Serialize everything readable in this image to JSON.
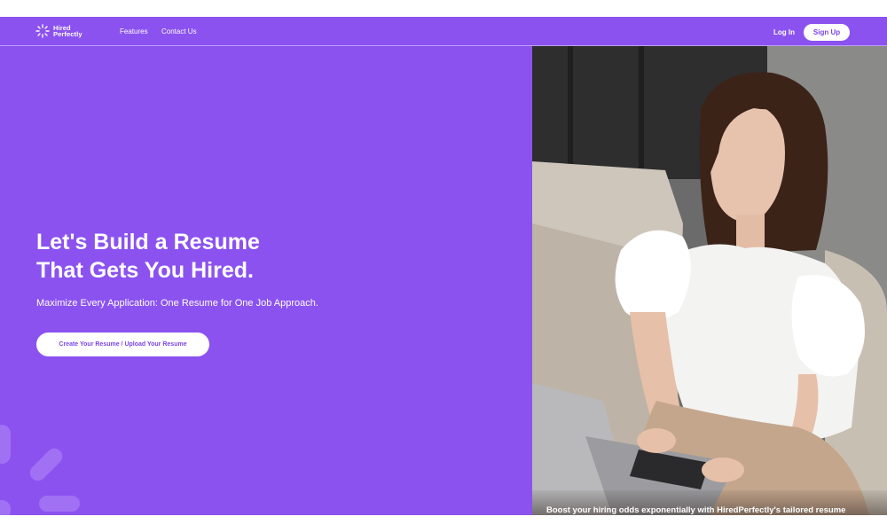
{
  "brand": {
    "line1": "Hired",
    "line2": "Perfectly",
    "color": "#8b52f0",
    "logo_icon": "sparkle-burst-icon"
  },
  "nav": {
    "links": [
      "Features",
      "Contact Us"
    ],
    "login_label": "Log In",
    "signup_label": "Sign Up"
  },
  "hero": {
    "title_line1": "Let's Build a Resume",
    "title_line2": "That Gets You Hired.",
    "subtitle": "Maximize Every Application: One Resume for One Job Approach.",
    "cta_label": "Create Your Resume / Upload Your Resume"
  },
  "photo": {
    "subject": "woman-using-laptop-photo",
    "caption": "Boost your hiring odds exponentially with HiredPerfectly's tailored resume"
  }
}
